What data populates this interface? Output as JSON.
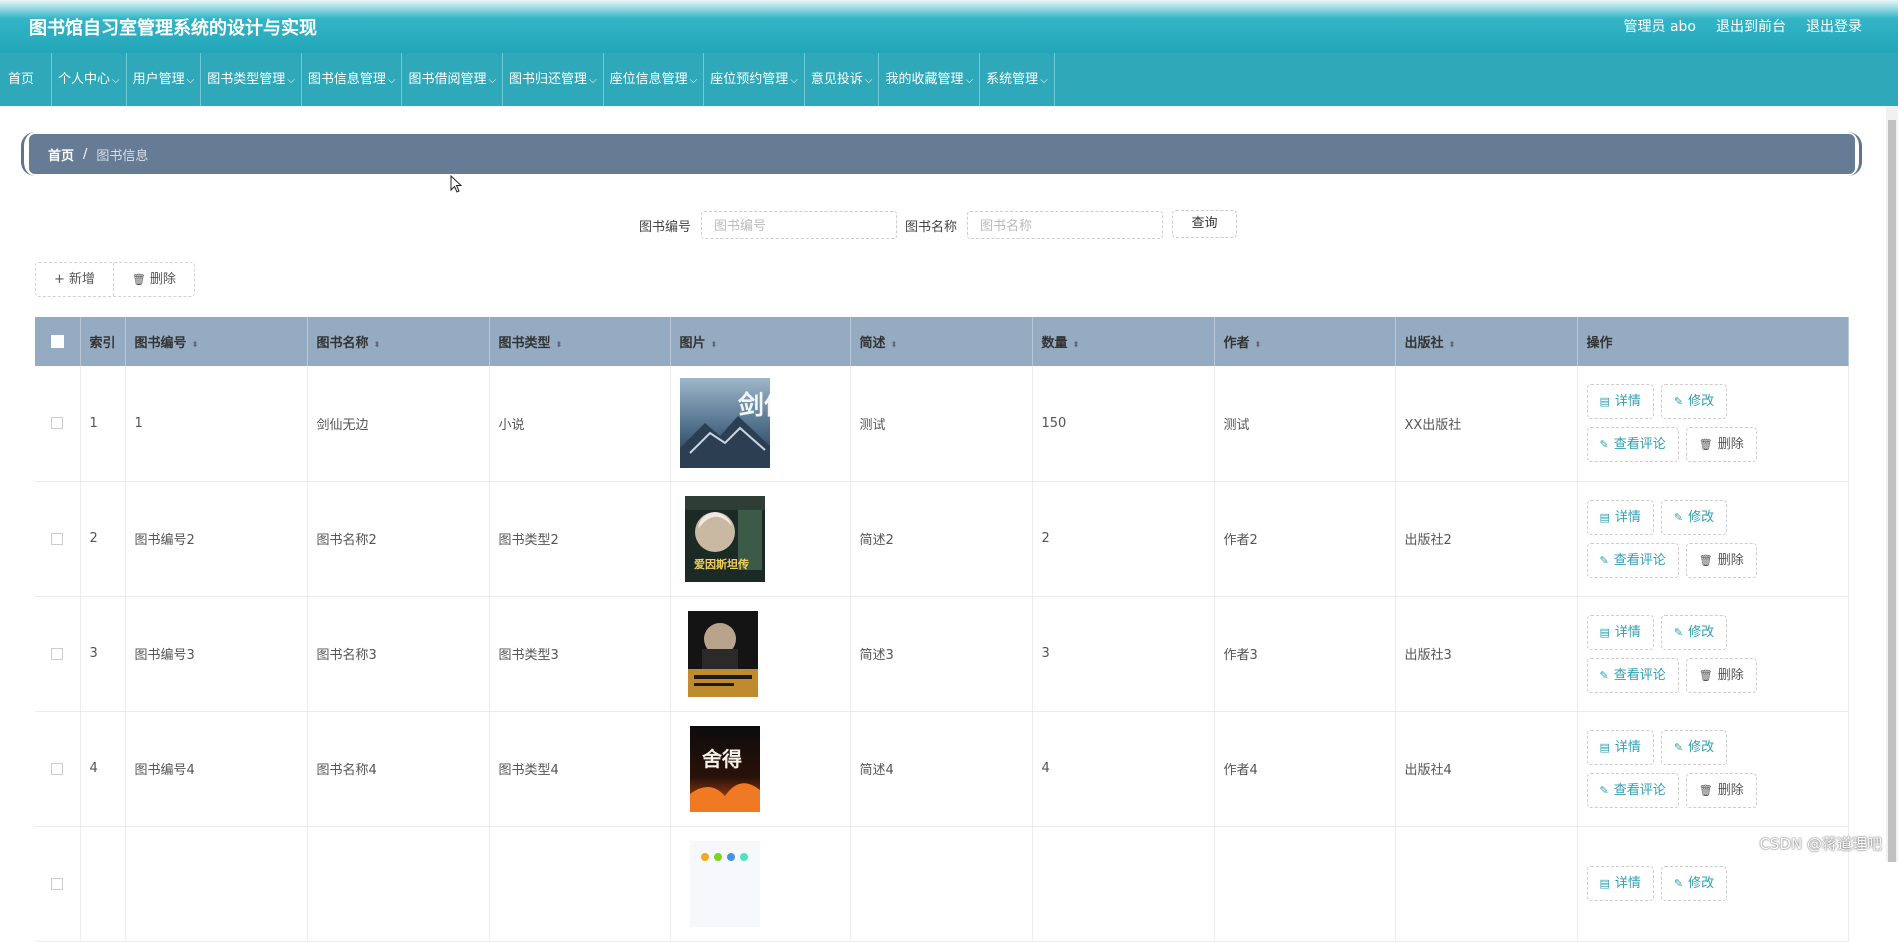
{
  "header": {
    "title": "图书馆自习室管理系统的设计与实现",
    "admin_label": "管理员 abo",
    "front_link": "退出到前台",
    "logout_link": "退出登录"
  },
  "nav": [
    {
      "label": "首页",
      "chevron": false
    },
    {
      "label": "个人中心",
      "chevron": true
    },
    {
      "label": "用户管理",
      "chevron": true
    },
    {
      "label": "图书类型管理",
      "chevron": true
    },
    {
      "label": "图书信息管理",
      "chevron": true
    },
    {
      "label": "图书借阅管理",
      "chevron": true
    },
    {
      "label": "图书归还管理",
      "chevron": true
    },
    {
      "label": "座位信息管理",
      "chevron": true
    },
    {
      "label": "座位预约管理",
      "chevron": true
    },
    {
      "label": "意见投诉",
      "chevron": true
    },
    {
      "label": "我的收藏管理",
      "chevron": true
    },
    {
      "label": "系统管理",
      "chevron": true
    }
  ],
  "breadcrumb": {
    "home": "首页",
    "sep": "/",
    "current": "图书信息"
  },
  "search": {
    "code_label": "图书编号",
    "code_placeholder": "图书编号",
    "name_label": "图书名称",
    "name_placeholder": "图书名称",
    "query_button": "查询"
  },
  "actions": {
    "add": "新增",
    "delete": "删除"
  },
  "table": {
    "headers": [
      "索引",
      "图书编号",
      "图书名称",
      "图书类型",
      "图片",
      "简述",
      "数量",
      "作者",
      "出版社",
      "操作"
    ],
    "rows": [
      {
        "index": "1",
        "code": "1",
        "name": "剑仙无边",
        "type": "小说",
        "cover": "剑仙无边",
        "desc": "测试",
        "qty": "150",
        "author": "测试",
        "publisher": "XX出版社"
      },
      {
        "index": "2",
        "code": "图书编号2",
        "name": "图书名称2",
        "type": "图书类型2",
        "cover": "爱因斯坦传",
        "desc": "简述2",
        "qty": "2",
        "author": "作者2",
        "publisher": "出版社2"
      },
      {
        "index": "3",
        "code": "图书编号3",
        "name": "图书名称3",
        "type": "图书类型3",
        "cover": "",
        "desc": "简述3",
        "qty": "3",
        "author": "作者3",
        "publisher": "出版社3"
      },
      {
        "index": "4",
        "code": "图书编号4",
        "name": "图书名称4",
        "type": "图书类型4",
        "cover": "舍得",
        "desc": "简述4",
        "qty": "4",
        "author": "作者4",
        "publisher": "出版社4"
      },
      {
        "index": "",
        "code": "",
        "name": "",
        "type": "",
        "cover": "",
        "desc": "",
        "qty": "",
        "author": "",
        "publisher": ""
      }
    ],
    "row_actions": {
      "detail": "详情",
      "edit": "修改",
      "comments": "查看评论",
      "delete": "删除"
    }
  },
  "watermark": "CSDN @蒋道理吧",
  "colors": {
    "header": "#23a6b8",
    "nav": "#2fa8b9",
    "breadcrumb": "#667b94",
    "table_head": "#95abc2",
    "accent": "#2fa0b2"
  }
}
